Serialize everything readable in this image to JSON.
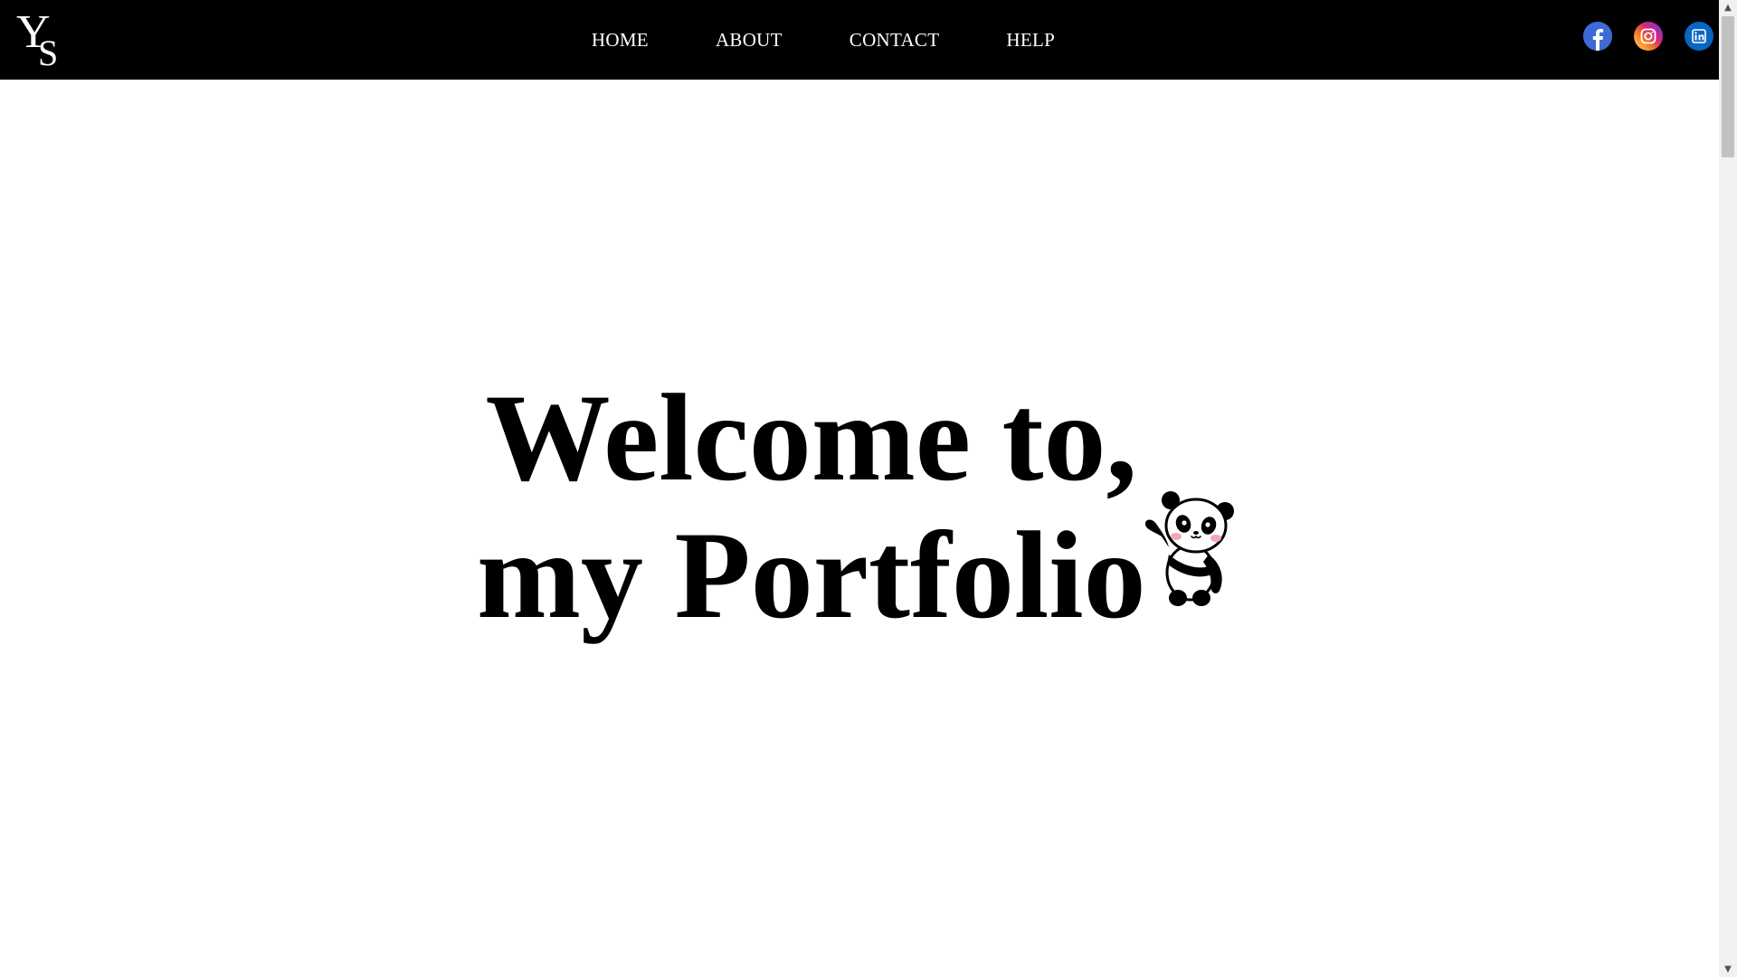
{
  "nav": {
    "logo_text": "YS",
    "items": [
      {
        "label": "HOME"
      },
      {
        "label": "ABOUT"
      },
      {
        "label": "CONTACT"
      },
      {
        "label": "HELP"
      }
    ],
    "social": [
      {
        "name": "facebook-icon",
        "color": "#3b5998"
      },
      {
        "name": "instagram-icon",
        "color": "#d6249f"
      },
      {
        "name": "linkedin-icon",
        "color": "#0a66c2"
      }
    ]
  },
  "hero": {
    "line1": "Welcome to,",
    "line2": "my Portfolio",
    "mascot": "panda-waving"
  },
  "colors": {
    "navbar_bg": "#000000",
    "page_bg": "#ffffff",
    "text": "#000000"
  }
}
